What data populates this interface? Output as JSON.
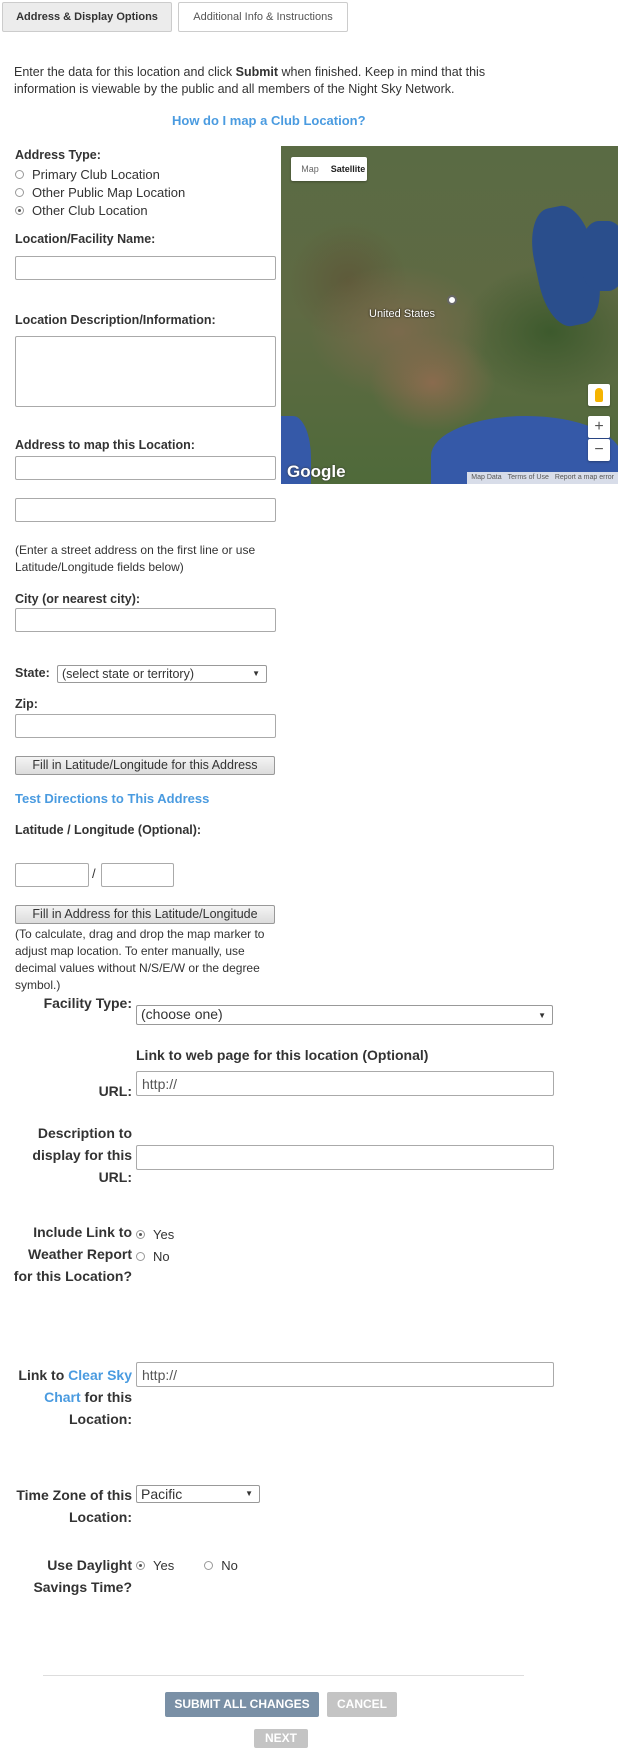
{
  "tabs": [
    {
      "label": "Address & Display Options",
      "active": true
    },
    {
      "label": "Additional Info & Instructions",
      "active": false
    }
  ],
  "intro": {
    "before": "Enter the data for this location and click ",
    "bold": "Submit",
    "after": " when finished. Keep in mind that this information is viewable by the public and all members of the Night Sky Network."
  },
  "how_to_link": "How do I map a Club Location?",
  "address_type": {
    "label": "Address Type:",
    "options": [
      "Primary Club Location",
      "Other Public Map Location",
      "Other Club Location"
    ],
    "selected": "Other Club Location"
  },
  "location_name": {
    "label": "Location/Facility Name:",
    "value": ""
  },
  "location_description": {
    "label": "Location Description/Information:",
    "value": ""
  },
  "address": {
    "label": "Address to map this Location:",
    "line1": "",
    "line2": ""
  },
  "address_help": "(Enter a street address on the first line or use Latitude/Longitude fields below)",
  "city": {
    "label": "City (or nearest city):",
    "value": ""
  },
  "state": {
    "label": "State:",
    "value": "(select state or territory)"
  },
  "zip": {
    "label": "Zip:",
    "value": ""
  },
  "fill_latlng_button": "Fill in Latitude/Longitude for this Address",
  "test_directions_link": "Test Directions to This Address",
  "latlng": {
    "label": "Latitude / Longitude (Optional):",
    "separator": "/",
    "lat": "",
    "lng": ""
  },
  "fill_address_button": "Fill in Address for this Latitude/Longitude",
  "latlng_help": "(To calculate, drag and drop the map marker to adjust map location. To enter manually, use decimal values without N/S/E/W or the degree symbol.)",
  "map": {
    "type_map": "Map",
    "type_satellite": "Satellite",
    "country_label": "United States",
    "zoom_in": "+",
    "zoom_out": "−",
    "logo": "Google",
    "footer": [
      "Map Data",
      "Terms of Use",
      "Report a map error"
    ]
  },
  "facility_type": {
    "label": "Facility Type:",
    "value": "(choose one)"
  },
  "web_link_heading": "Link to web page for this location (Optional)",
  "url": {
    "label": "URL:",
    "value": "http://"
  },
  "url_description": {
    "label": "Description to display for this URL:",
    "value": ""
  },
  "weather": {
    "label": "Include Link to Weather Report for this Location?",
    "options": [
      "Yes",
      "No"
    ],
    "selected": "Yes"
  },
  "clear_sky": {
    "label_before": "Link to",
    "label_link": "Clear Sky Chart",
    "label_after": "for this Location:",
    "value": "http://"
  },
  "time_zone": {
    "label": "Time Zone of this Location:",
    "value": "Pacific"
  },
  "dst": {
    "label": "Use Daylight Savings Time?",
    "options": [
      "Yes",
      "No"
    ],
    "selected": "Yes"
  },
  "actions": {
    "submit": "SUBMIT ALL CHANGES",
    "cancel": "CANCEL",
    "next": "NEXT"
  },
  "colors": {
    "link": "#4a9be0",
    "submit_bg": "#7a90a6",
    "disabled_bg": "#c4c4c4"
  }
}
